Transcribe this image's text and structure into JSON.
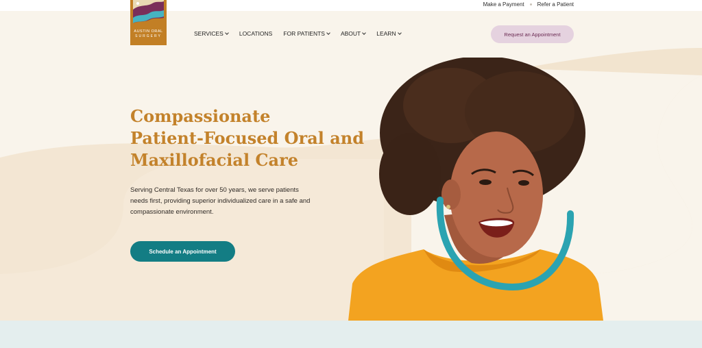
{
  "topbar": {
    "make_payment": "Make a Payment",
    "refer_patient": "Refer a Patient"
  },
  "logo": {
    "line1": "AUSTIN ORAL",
    "line2": "SURGERY"
  },
  "nav": {
    "items": [
      {
        "label": "SERVICES",
        "has_dropdown": true
      },
      {
        "label": "LOCATIONS",
        "has_dropdown": false
      },
      {
        "label": "FOR PATIENTS",
        "has_dropdown": true
      },
      {
        "label": "ABOUT",
        "has_dropdown": true
      },
      {
        "label": "LEARN",
        "has_dropdown": true
      }
    ],
    "cta_label": "Request an Appointment"
  },
  "hero": {
    "title_lines": [
      "Compassionate",
      "Patient-Focused Oral and",
      "Maxillofacial Care"
    ],
    "body_lines": [
      "Serving Central Texas for over 50 years, we serve patients",
      "needs first, providing superior individualized care in a safe and",
      "compassionate environment."
    ],
    "cta_label": "Schedule an Appointment"
  },
  "colors": {
    "brand_gold": "#c3822b",
    "teal": "#137d84",
    "cream": "#f9f4eb",
    "pink_button": "#e5d2df"
  }
}
